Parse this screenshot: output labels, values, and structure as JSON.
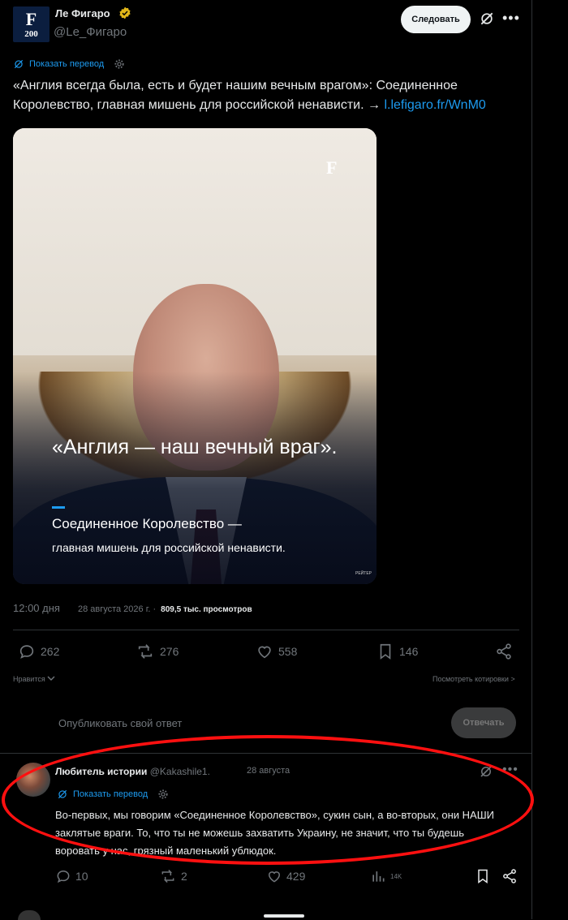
{
  "account": {
    "name": "Ле Фигаро",
    "handle": "@Le_Фигаро",
    "avatar_letter": "F",
    "avatar_text": "200",
    "follow_label": "Следовать"
  },
  "post": {
    "translate_label": "Показать перевод",
    "text": "«Англия всегда была, есть и будет нашим вечным врагом»: Соединенное Королевство, главная мишень для российской ненависти. →",
    "link": "l.lefigaro.fr/WnM0",
    "media": {
      "watermark": "F",
      "quote": "«Англия — наш вечный враг».",
      "subtitle_line1": "Соединенное Королевство —",
      "subtitle_line2": "главная мишень для российской ненависти.",
      "credit": "РЕЙТЕР"
    },
    "time": "12:00 дня",
    "date": "28 августа 2026 г. ·",
    "views": "809,5 тыс. просмотров",
    "replies": "262",
    "reposts": "276",
    "likes": "558",
    "bookmarks": "146",
    "likes_label": "Нравится",
    "quotes_label": "Посмотреть котировки >"
  },
  "reply_box": {
    "placeholder": "Опубликовать свой ответ",
    "button": "Отвечать"
  },
  "comment": {
    "name": "Любитель истории",
    "handle": "@Kakashile1.",
    "date": "28 августа",
    "translate_label": "Показать перевод",
    "text": "Во-первых, мы говорим «Соединенное Королевство», сукин сын, а во-вторых, они НАШИ заклятые враги. То, что ты не можешь захватить Украину, не значит, что ты будешь воровать у нас, грязный маленький ублюдок.",
    "replies": "10",
    "reposts": "2",
    "likes": "429",
    "views": "14K"
  },
  "colors": {
    "background": "#000000",
    "accent": "#1d9bf0",
    "annotation": "#ff1010"
  }
}
